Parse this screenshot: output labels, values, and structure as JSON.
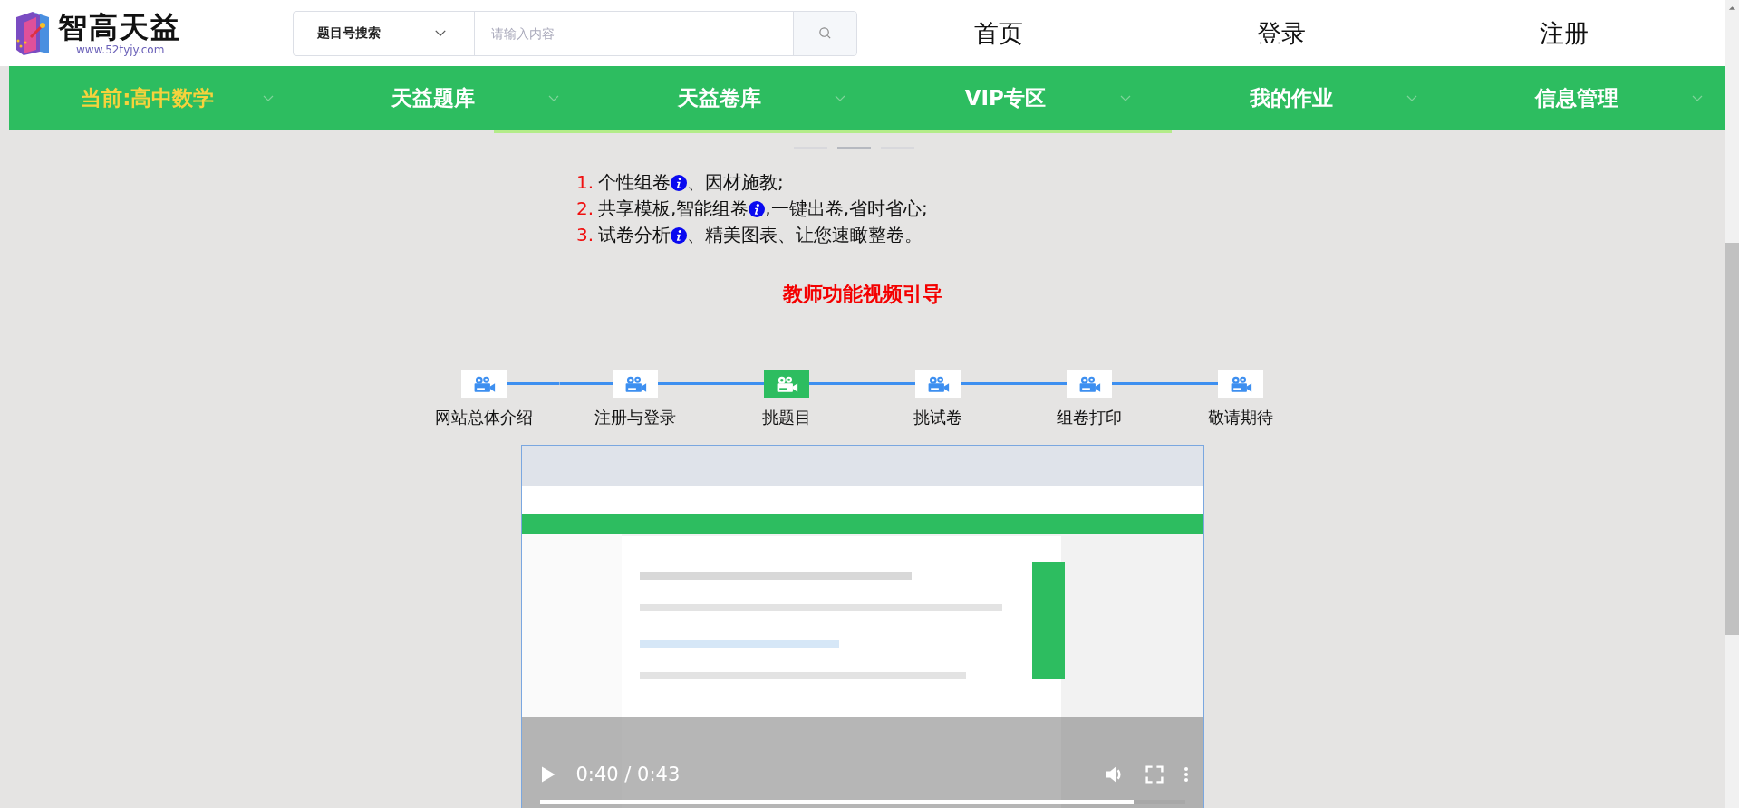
{
  "logo": {
    "name": "智高天益",
    "url": "www.52tyjy.com"
  },
  "search": {
    "mode": "题目号搜索",
    "placeholder": "请输入内容"
  },
  "top_links": [
    "首页",
    "登录",
    "注册"
  ],
  "nav": [
    {
      "label": "当前:高中数学",
      "selected": true
    },
    {
      "label": "天益题库",
      "selected": false
    },
    {
      "label": "天益卷库",
      "selected": false
    },
    {
      "label": "VIP专区",
      "selected": false
    },
    {
      "label": "我的作业",
      "selected": false
    },
    {
      "label": "信息管理",
      "selected": false
    }
  ],
  "carousel_dots": [
    {
      "selected": false
    },
    {
      "selected": true
    },
    {
      "selected": false
    }
  ],
  "features": [
    {
      "number": "1.",
      "parts": [
        "个性组卷",
        "、因材施教;"
      ]
    },
    {
      "number": "2.",
      "parts": [
        "共享模板,智能组卷",
        ",一键出卷,省时省心;"
      ]
    },
    {
      "number": "3.",
      "parts": [
        "试卷分析",
        "、精美图表、让您速瞰整卷。"
      ]
    }
  ],
  "section_title": "教师功能视频引导",
  "steps": [
    {
      "label": "网站总体介绍",
      "selected": false
    },
    {
      "label": "注册与登录",
      "selected": false
    },
    {
      "label": "挑题目",
      "selected": true
    },
    {
      "label": "挑试卷",
      "selected": false
    },
    {
      "label": "组卷打印",
      "selected": false
    },
    {
      "label": "敬请期待",
      "selected": false
    }
  ],
  "video": {
    "kind": "picture",
    "time": "0:40 / 0:43",
    "level": 0.92
  }
}
